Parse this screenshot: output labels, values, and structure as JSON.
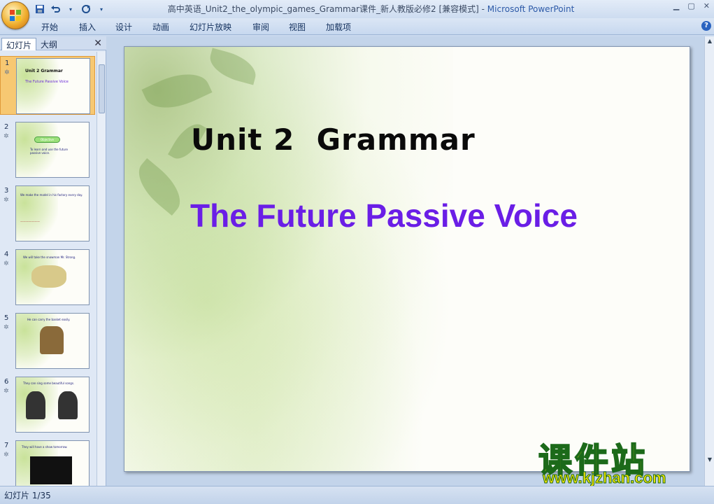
{
  "window": {
    "title": "高中英语_Unit2_the_olympic_games_Grammar课件_新人教版必修2 [兼容模式] - ",
    "app_name": "Microsoft PowerPoint"
  },
  "ribbon": {
    "tabs": [
      "开始",
      "插入",
      "设计",
      "动画",
      "幻灯片放映",
      "审阅",
      "视图",
      "加载项"
    ]
  },
  "panel": {
    "tab_slides": "幻灯片",
    "tab_outline": "大纲",
    "close": "✕"
  },
  "thumbnails": [
    {
      "num": "1",
      "title": "Unit 2  Grammar",
      "sub": "The Future Passive Voice"
    },
    {
      "num": "2",
      "title": "Objective",
      "sub": "To learn and use the future passive voice."
    },
    {
      "num": "3",
      "title": "",
      "sub": "We make the model in his factory every day."
    },
    {
      "num": "4",
      "title": "",
      "sub": "We will take the snowman Mr. Strong."
    },
    {
      "num": "5",
      "title": "",
      "sub": "He can carry the basket easily."
    },
    {
      "num": "6",
      "title": "",
      "sub": "They can sing some beautiful songs."
    },
    {
      "num": "7",
      "title": "",
      "sub": "They will have a show tomorrow."
    }
  ],
  "slide": {
    "title": "Unit 2  Grammar",
    "subtitle": "The Future Passive Voice"
  },
  "watermark": {
    "cn": "课件站",
    "url": "www.kjzhan.com"
  },
  "status": {
    "slide_counter": "幻灯片 1/35"
  },
  "colors": {
    "subtitle": "#6a1ee6",
    "selected_thumb": "#f7c872",
    "watermark_fill": "#f4e400"
  }
}
